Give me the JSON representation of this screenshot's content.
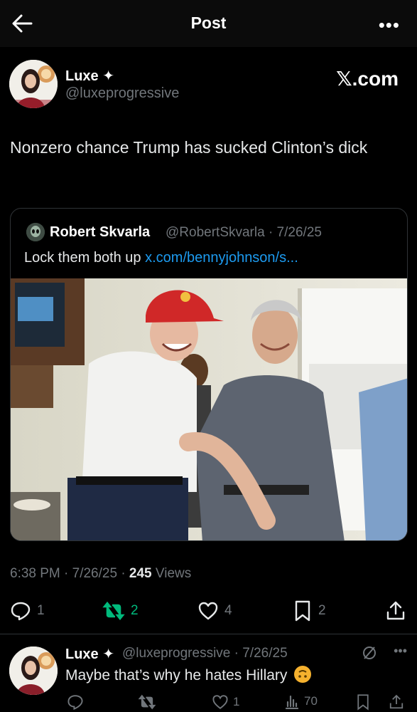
{
  "header": {
    "title": "Post",
    "back_icon": "arrow-left-icon",
    "more_icon": "more-icon",
    "more_label": "•••"
  },
  "post": {
    "author_name": "Luxe",
    "author_badge": "✦",
    "author_handle": "@luxeprogressive",
    "watermark": "𝕏.com",
    "text": "Nonzero chance Trump has sucked Clinton’s dick",
    "timestamp": "6:38 PM · 7/26/25 · ",
    "views_count": "245",
    "views_label": " Views"
  },
  "quote": {
    "author_name": "Robert Skvarla",
    "author_handle": "@RobertSkvarla",
    "date": "7/26/25",
    "meta": "@RobertSkvarla · 7/26/25",
    "text_prefix": "Lock them both up ",
    "link": "x.com/bennyjohnson/s..."
  },
  "actions": {
    "replies": "1",
    "reposts": "2",
    "likes": "4",
    "bookmarks": "2"
  },
  "reply": {
    "author_name": "Luxe",
    "author_badge": "✦",
    "meta": "@luxeprogressive · 7/26/25",
    "text": "Maybe that’s why he hates Hillary",
    "likes": "1",
    "views": "70"
  },
  "colors": {
    "background": "#000000",
    "text": "#e7e9ea",
    "muted": "#71767b",
    "link": "#1d9bf0",
    "repost_active": "#00ba7c",
    "border": "#2f3336"
  }
}
